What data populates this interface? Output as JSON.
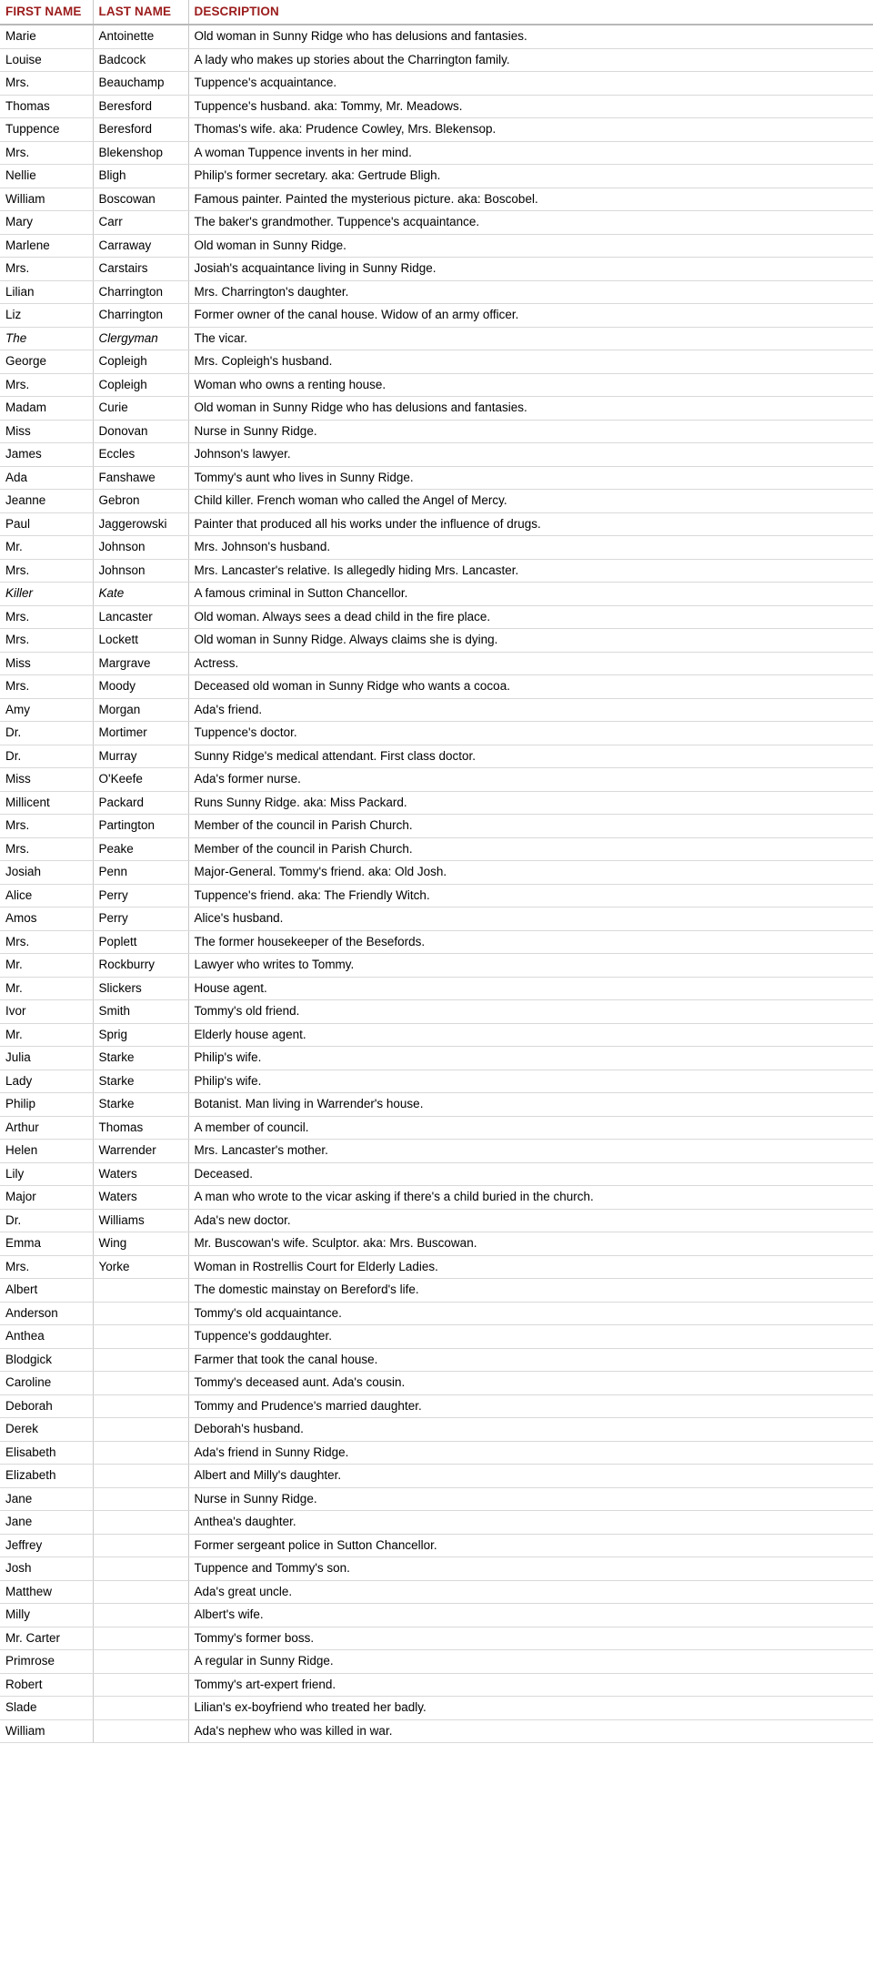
{
  "table": {
    "columns": [
      "FIRST NAME",
      "LAST NAME",
      "DESCRIPTION"
    ],
    "rows": [
      {
        "first": "Marie",
        "last": "Antoinette",
        "desc": "Old woman in Sunny Ridge who has delusions and fantasies.",
        "italic": false
      },
      {
        "first": "Louise",
        "last": "Badcock",
        "desc": "A lady who makes up stories about the Charrington family.",
        "italic": false
      },
      {
        "first": "Mrs.",
        "last": "Beauchamp",
        "desc": "Tuppence's acquaintance.",
        "italic": false
      },
      {
        "first": "Thomas",
        "last": "Beresford",
        "desc": "Tuppence's husband. aka: Tommy, Mr. Meadows.",
        "italic": false
      },
      {
        "first": "Tuppence",
        "last": "Beresford",
        "desc": "Thomas's wife. aka: Prudence Cowley, Mrs. Blekensop.",
        "italic": false
      },
      {
        "first": "Mrs.",
        "last": "Blekenshop",
        "desc": "A woman Tuppence invents in her mind.",
        "italic": false
      },
      {
        "first": "Nellie",
        "last": "Bligh",
        "desc": "Philip's former secretary. aka: Gertrude Bligh.",
        "italic": false
      },
      {
        "first": "William",
        "last": "Boscowan",
        "desc": "Famous painter. Painted the mysterious picture. aka: Boscobel.",
        "italic": false
      },
      {
        "first": "Mary",
        "last": "Carr",
        "desc": "The baker's grandmother. Tuppence's acquaintance.",
        "italic": false
      },
      {
        "first": "Marlene",
        "last": "Carraway",
        "desc": "Old woman in Sunny Ridge.",
        "italic": false
      },
      {
        "first": "Mrs.",
        "last": "Carstairs",
        "desc": "Josiah's acquaintance living in Sunny Ridge.",
        "italic": false
      },
      {
        "first": "Lilian",
        "last": "Charrington",
        "desc": "Mrs. Charrington's daughter.",
        "italic": false
      },
      {
        "first": "Liz",
        "last": "Charrington",
        "desc": "Former owner of the canal house. Widow of an army officer.",
        "italic": false
      },
      {
        "first": "The",
        "last": "Clergyman",
        "desc": "The vicar.",
        "italic": true
      },
      {
        "first": "George",
        "last": "Copleigh",
        "desc": "Mrs. Copleigh's husband.",
        "italic": false
      },
      {
        "first": "Mrs.",
        "last": "Copleigh",
        "desc": "Woman who owns a renting house.",
        "italic": false
      },
      {
        "first": "Madam",
        "last": "Curie",
        "desc": "Old woman in Sunny Ridge who has delusions and fantasies.",
        "italic": false
      },
      {
        "first": "Miss",
        "last": "Donovan",
        "desc": "Nurse in Sunny Ridge.",
        "italic": false
      },
      {
        "first": "James",
        "last": "Eccles",
        "desc": "Johnson's lawyer.",
        "italic": false
      },
      {
        "first": "Ada",
        "last": "Fanshawe",
        "desc": "Tommy's aunt who lives in Sunny Ridge.",
        "italic": false
      },
      {
        "first": "Jeanne",
        "last": "Gebron",
        "desc": "Child killer. French woman who called the Angel of Mercy.",
        "italic": false
      },
      {
        "first": "Paul",
        "last": "Jaggerowski",
        "desc": "Painter that produced all his works under the influence of drugs.",
        "italic": false
      },
      {
        "first": "Mr.",
        "last": "Johnson",
        "desc": "Mrs. Johnson's husband.",
        "italic": false
      },
      {
        "first": "Mrs.",
        "last": "Johnson",
        "desc": "Mrs. Lancaster's relative. Is allegedly hiding Mrs. Lancaster.",
        "italic": false
      },
      {
        "first": "Killer",
        "last": "Kate",
        "desc": "A famous criminal in Sutton Chancellor.",
        "italic": true
      },
      {
        "first": "Mrs.",
        "last": "Lancaster",
        "desc": "Old woman. Always sees a dead child in the fire place.",
        "italic": false
      },
      {
        "first": "Mrs.",
        "last": "Lockett",
        "desc": "Old woman in Sunny Ridge. Always claims she is dying.",
        "italic": false
      },
      {
        "first": "Miss",
        "last": "Margrave",
        "desc": "Actress.",
        "italic": false
      },
      {
        "first": "Mrs.",
        "last": "Moody",
        "desc": "Deceased old woman in Sunny Ridge who wants a cocoa.",
        "italic": false
      },
      {
        "first": "Amy",
        "last": "Morgan",
        "desc": "Ada's friend.",
        "italic": false
      },
      {
        "first": "Dr.",
        "last": "Mortimer",
        "desc": "Tuppence's doctor.",
        "italic": false
      },
      {
        "first": "Dr.",
        "last": "Murray",
        "desc": "Sunny Ridge's medical attendant. First class doctor.",
        "italic": false
      },
      {
        "first": "Miss",
        "last": "O'Keefe",
        "desc": "Ada's former nurse.",
        "italic": false
      },
      {
        "first": "Millicent",
        "last": "Packard",
        "desc": "Runs Sunny Ridge. aka: Miss Packard.",
        "italic": false
      },
      {
        "first": "Mrs.",
        "last": "Partington",
        "desc": "Member of the council in Parish Church.",
        "italic": false
      },
      {
        "first": "Mrs.",
        "last": "Peake",
        "desc": "Member of the council in Parish Church.",
        "italic": false
      },
      {
        "first": "Josiah",
        "last": "Penn",
        "desc": "Major-General. Tommy's friend. aka: Old Josh.",
        "italic": false
      },
      {
        "first": "Alice",
        "last": "Perry",
        "desc": "Tuppence's friend. aka: The Friendly Witch.",
        "italic": false
      },
      {
        "first": "Amos",
        "last": "Perry",
        "desc": "Alice's husband.",
        "italic": false
      },
      {
        "first": "Mrs.",
        "last": "Poplett",
        "desc": "The former housekeeper of the Besefords.",
        "italic": false
      },
      {
        "first": "Mr.",
        "last": "Rockburry",
        "desc": "Lawyer who writes to Tommy.",
        "italic": false
      },
      {
        "first": "Mr.",
        "last": "Slickers",
        "desc": "House agent.",
        "italic": false
      },
      {
        "first": "Ivor",
        "last": "Smith",
        "desc": "Tommy's old friend.",
        "italic": false
      },
      {
        "first": "Mr.",
        "last": "Sprig",
        "desc": "Elderly house agent.",
        "italic": false
      },
      {
        "first": "Julia",
        "last": "Starke",
        "desc": "Philip's wife.",
        "italic": false
      },
      {
        "first": "Lady",
        "last": "Starke",
        "desc": "Philip's wife.",
        "italic": false
      },
      {
        "first": "Philip",
        "last": "Starke",
        "desc": "Botanist. Man living in Warrender's house.",
        "italic": false
      },
      {
        "first": "Arthur",
        "last": "Thomas",
        "desc": "A member of council.",
        "italic": false
      },
      {
        "first": "Helen",
        "last": "Warrender",
        "desc": "Mrs. Lancaster's mother.",
        "italic": false
      },
      {
        "first": "Lily",
        "last": "Waters",
        "desc": "Deceased.",
        "italic": false
      },
      {
        "first": "Major",
        "last": "Waters",
        "desc": "A man who wrote to the vicar asking if there's a child buried in the church.",
        "italic": false
      },
      {
        "first": "Dr.",
        "last": "Williams",
        "desc": "Ada's new doctor.",
        "italic": false
      },
      {
        "first": "Emma",
        "last": "Wing",
        "desc": "Mr. Buscowan's wife. Sculptor. aka: Mrs. Buscowan.",
        "italic": false
      },
      {
        "first": "Mrs.",
        "last": "Yorke",
        "desc": "Woman in Rostrellis Court for Elderly Ladies.",
        "italic": false
      },
      {
        "first": "Albert",
        "last": "",
        "desc": "The domestic mainstay on Bereford's life.",
        "italic": false
      },
      {
        "first": "Anderson",
        "last": "",
        "desc": "Tommy's old acquaintance.",
        "italic": false
      },
      {
        "first": "Anthea",
        "last": "",
        "desc": "Tuppence's goddaughter.",
        "italic": false
      },
      {
        "first": "Blodgick",
        "last": "",
        "desc": "Farmer that took the canal house.",
        "italic": false
      },
      {
        "first": "Caroline",
        "last": "",
        "desc": "Tommy's deceased aunt. Ada's cousin.",
        "italic": false
      },
      {
        "first": "Deborah",
        "last": "",
        "desc": "Tommy and Prudence's married daughter.",
        "italic": false
      },
      {
        "first": "Derek",
        "last": "",
        "desc": "Deborah's husband.",
        "italic": false
      },
      {
        "first": "Elisabeth",
        "last": "",
        "desc": "Ada's friend in Sunny Ridge.",
        "italic": false
      },
      {
        "first": "Elizabeth",
        "last": "",
        "desc": "Albert and Milly's daughter.",
        "italic": false
      },
      {
        "first": "Jane",
        "last": "",
        "desc": "Nurse in Sunny Ridge.",
        "italic": false
      },
      {
        "first": "Jane",
        "last": "",
        "desc": "Anthea's daughter.",
        "italic": false
      },
      {
        "first": "Jeffrey",
        "last": "",
        "desc": "Former sergeant police in Sutton Chancellor.",
        "italic": false
      },
      {
        "first": "Josh",
        "last": "",
        "desc": "Tuppence and Tommy's son.",
        "italic": false
      },
      {
        "first": "Matthew",
        "last": "",
        "desc": "Ada's great uncle.",
        "italic": false
      },
      {
        "first": "Milly",
        "last": "",
        "desc": "Albert's wife.",
        "italic": false
      },
      {
        "first": "Mr. Carter",
        "last": "",
        "desc": "Tommy's former boss.",
        "italic": false
      },
      {
        "first": "Primrose",
        "last": "",
        "desc": "A regular in Sunny Ridge.",
        "italic": false
      },
      {
        "first": "Robert",
        "last": "",
        "desc": "Tommy's art-expert friend.",
        "italic": false
      },
      {
        "first": "Slade",
        "last": "",
        "desc": "Lilian's ex-boyfriend who treated her badly.",
        "italic": false
      },
      {
        "first": "William",
        "last": "",
        "desc": "Ada's nephew who was killed in war.",
        "italic": false
      }
    ]
  },
  "colors": {
    "header_text": "#9b1b1b",
    "grid_line": "#d9d9d9",
    "body_text": "#000000",
    "background": "#ffffff"
  }
}
